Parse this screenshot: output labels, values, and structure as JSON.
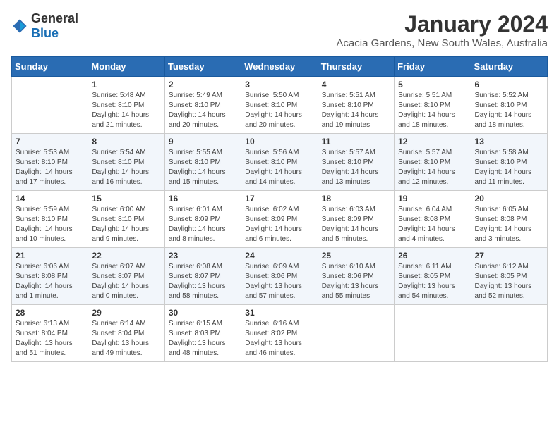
{
  "logo": {
    "text_general": "General",
    "text_blue": "Blue"
  },
  "title": "January 2024",
  "subtitle": "Acacia Gardens, New South Wales, Australia",
  "days_of_week": [
    "Sunday",
    "Monday",
    "Tuesday",
    "Wednesday",
    "Thursday",
    "Friday",
    "Saturday"
  ],
  "weeks": [
    [
      {
        "day": "",
        "info": ""
      },
      {
        "day": "1",
        "info": "Sunrise: 5:48 AM\nSunset: 8:10 PM\nDaylight: 14 hours\nand 21 minutes."
      },
      {
        "day": "2",
        "info": "Sunrise: 5:49 AM\nSunset: 8:10 PM\nDaylight: 14 hours\nand 20 minutes."
      },
      {
        "day": "3",
        "info": "Sunrise: 5:50 AM\nSunset: 8:10 PM\nDaylight: 14 hours\nand 20 minutes."
      },
      {
        "day": "4",
        "info": "Sunrise: 5:51 AM\nSunset: 8:10 PM\nDaylight: 14 hours\nand 19 minutes."
      },
      {
        "day": "5",
        "info": "Sunrise: 5:51 AM\nSunset: 8:10 PM\nDaylight: 14 hours\nand 18 minutes."
      },
      {
        "day": "6",
        "info": "Sunrise: 5:52 AM\nSunset: 8:10 PM\nDaylight: 14 hours\nand 18 minutes."
      }
    ],
    [
      {
        "day": "7",
        "info": "Sunrise: 5:53 AM\nSunset: 8:10 PM\nDaylight: 14 hours\nand 17 minutes."
      },
      {
        "day": "8",
        "info": "Sunrise: 5:54 AM\nSunset: 8:10 PM\nDaylight: 14 hours\nand 16 minutes."
      },
      {
        "day": "9",
        "info": "Sunrise: 5:55 AM\nSunset: 8:10 PM\nDaylight: 14 hours\nand 15 minutes."
      },
      {
        "day": "10",
        "info": "Sunrise: 5:56 AM\nSunset: 8:10 PM\nDaylight: 14 hours\nand 14 minutes."
      },
      {
        "day": "11",
        "info": "Sunrise: 5:57 AM\nSunset: 8:10 PM\nDaylight: 14 hours\nand 13 minutes."
      },
      {
        "day": "12",
        "info": "Sunrise: 5:57 AM\nSunset: 8:10 PM\nDaylight: 14 hours\nand 12 minutes."
      },
      {
        "day": "13",
        "info": "Sunrise: 5:58 AM\nSunset: 8:10 PM\nDaylight: 14 hours\nand 11 minutes."
      }
    ],
    [
      {
        "day": "14",
        "info": "Sunrise: 5:59 AM\nSunset: 8:10 PM\nDaylight: 14 hours\nand 10 minutes."
      },
      {
        "day": "15",
        "info": "Sunrise: 6:00 AM\nSunset: 8:10 PM\nDaylight: 14 hours\nand 9 minutes."
      },
      {
        "day": "16",
        "info": "Sunrise: 6:01 AM\nSunset: 8:09 PM\nDaylight: 14 hours\nand 8 minutes."
      },
      {
        "day": "17",
        "info": "Sunrise: 6:02 AM\nSunset: 8:09 PM\nDaylight: 14 hours\nand 6 minutes."
      },
      {
        "day": "18",
        "info": "Sunrise: 6:03 AM\nSunset: 8:09 PM\nDaylight: 14 hours\nand 5 minutes."
      },
      {
        "day": "19",
        "info": "Sunrise: 6:04 AM\nSunset: 8:08 PM\nDaylight: 14 hours\nand 4 minutes."
      },
      {
        "day": "20",
        "info": "Sunrise: 6:05 AM\nSunset: 8:08 PM\nDaylight: 14 hours\nand 3 minutes."
      }
    ],
    [
      {
        "day": "21",
        "info": "Sunrise: 6:06 AM\nSunset: 8:08 PM\nDaylight: 14 hours\nand 1 minute."
      },
      {
        "day": "22",
        "info": "Sunrise: 6:07 AM\nSunset: 8:07 PM\nDaylight: 14 hours\nand 0 minutes."
      },
      {
        "day": "23",
        "info": "Sunrise: 6:08 AM\nSunset: 8:07 PM\nDaylight: 13 hours\nand 58 minutes."
      },
      {
        "day": "24",
        "info": "Sunrise: 6:09 AM\nSunset: 8:06 PM\nDaylight: 13 hours\nand 57 minutes."
      },
      {
        "day": "25",
        "info": "Sunrise: 6:10 AM\nSunset: 8:06 PM\nDaylight: 13 hours\nand 55 minutes."
      },
      {
        "day": "26",
        "info": "Sunrise: 6:11 AM\nSunset: 8:05 PM\nDaylight: 13 hours\nand 54 minutes."
      },
      {
        "day": "27",
        "info": "Sunrise: 6:12 AM\nSunset: 8:05 PM\nDaylight: 13 hours\nand 52 minutes."
      }
    ],
    [
      {
        "day": "28",
        "info": "Sunrise: 6:13 AM\nSunset: 8:04 PM\nDaylight: 13 hours\nand 51 minutes."
      },
      {
        "day": "29",
        "info": "Sunrise: 6:14 AM\nSunset: 8:04 PM\nDaylight: 13 hours\nand 49 minutes."
      },
      {
        "day": "30",
        "info": "Sunrise: 6:15 AM\nSunset: 8:03 PM\nDaylight: 13 hours\nand 48 minutes."
      },
      {
        "day": "31",
        "info": "Sunrise: 6:16 AM\nSunset: 8:02 PM\nDaylight: 13 hours\nand 46 minutes."
      },
      {
        "day": "",
        "info": ""
      },
      {
        "day": "",
        "info": ""
      },
      {
        "day": "",
        "info": ""
      }
    ]
  ]
}
